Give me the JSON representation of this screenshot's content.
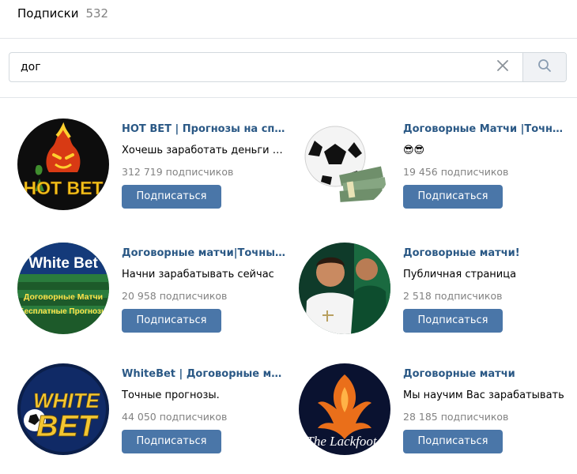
{
  "header": {
    "title": "Подписки",
    "count": "532"
  },
  "search": {
    "value": "дог",
    "clear_icon": "close-icon",
    "search_icon": "search-icon"
  },
  "colors": {
    "link": "#2a5885",
    "button": "#4a76a8",
    "muted": "#828282"
  },
  "groups": [
    {
      "name": "HOT BET | Прогнозы на спорт",
      "description": "Хочешь заработать деньги на ставках?",
      "subscribers": "312 719 подписчиков",
      "button": "Подписаться",
      "avatar_text": "HOT BET"
    },
    {
      "name": "Договорные Матчи |Точные прогнозы",
      "description": "😎😎",
      "subscribers": "19 456 подписчиков",
      "button": "Подписаться"
    },
    {
      "name": "Договорные матчи|Точные прогнозы",
      "description": "Начни зарабатывать сейчас",
      "subscribers": "20 958 подписчиков",
      "button": "Подписаться",
      "avatar_text": "White Bet",
      "avatar_subtext_1": "Договорные Матчи",
      "avatar_subtext_2": "Бесплатные Прогнозы"
    },
    {
      "name": "Договорные матчи!",
      "description": "Публичная страница",
      "subscribers": "2 518 подписчиков",
      "button": "Подписаться"
    },
    {
      "name": "WhiteBet | Договорные матчи",
      "description": "Точные прогнозы.",
      "subscribers": "44 050 подписчиков",
      "button": "Подписаться",
      "avatar_text_1": "WHITE",
      "avatar_text_2": "BET"
    },
    {
      "name": "Договорные матчи",
      "description": "Мы научим Вас зарабатывать",
      "subscribers": "28 185 подписчиков",
      "button": "Подписаться",
      "avatar_text": "The Lackfoot"
    }
  ]
}
